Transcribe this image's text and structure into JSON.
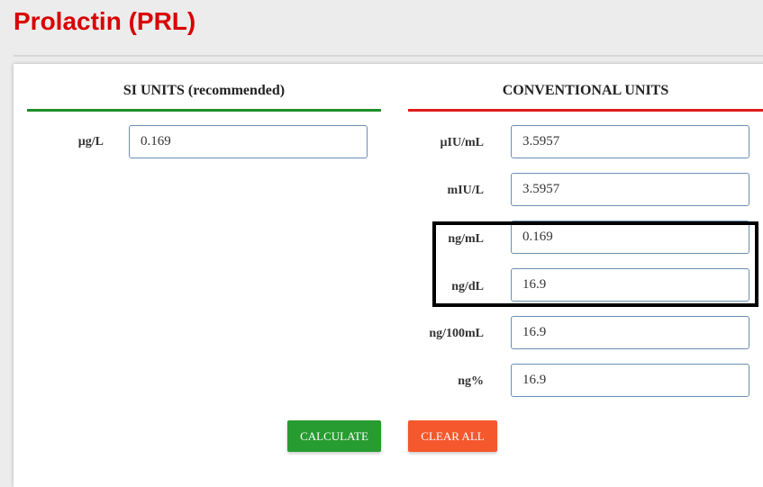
{
  "header": {
    "title": "Prolactin (PRL)"
  },
  "si": {
    "title": "SI UNITS (recommended)",
    "fields": [
      {
        "unit": "µg/L",
        "value": "0.169"
      }
    ]
  },
  "conventional": {
    "title": "CONVENTIONAL UNITS",
    "fields": [
      {
        "unit": "µIU/mL",
        "value": "3.5957"
      },
      {
        "unit": "mIU/L",
        "value": "3.5957"
      },
      {
        "unit": "ng/mL",
        "value": "0.169"
      },
      {
        "unit": "ng/dL",
        "value": "16.9"
      },
      {
        "unit": "ng/100mL",
        "value": "16.9"
      },
      {
        "unit": "ng%",
        "value": "16.9"
      }
    ]
  },
  "buttons": {
    "calculate": "CALCULATE",
    "clear": "CLEAR ALL"
  },
  "colors": {
    "title": "#d90000",
    "si_rule": "#1e8f2a",
    "conv_rule": "#e01b1b",
    "calculate": "#279c30",
    "clear": "#f5582c"
  }
}
